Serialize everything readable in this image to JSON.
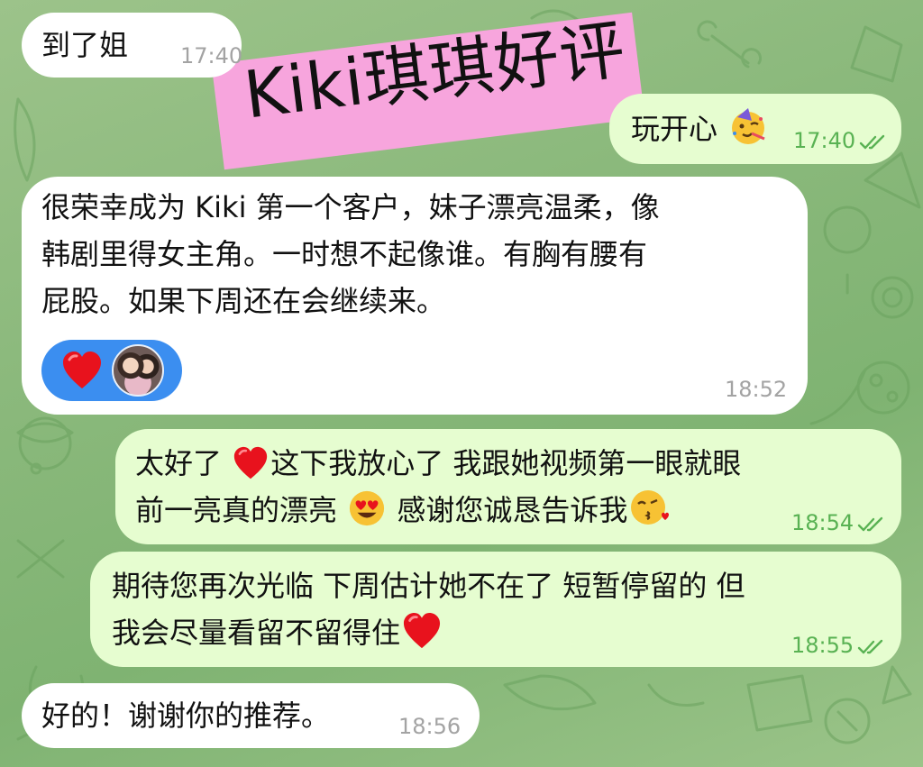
{
  "overlay": {
    "sticker_text": "Kiki琪琪好评"
  },
  "messages": [
    {
      "id": "m1",
      "direction": "incoming",
      "text": "到了姐",
      "time": "17:40"
    },
    {
      "id": "m2",
      "direction": "outgoing",
      "text": "玩开心",
      "emoji": "partying-face-emoji",
      "time": "17:40",
      "status": "read"
    },
    {
      "id": "m3",
      "direction": "incoming",
      "lines": [
        "很荣幸成为 Kiki 第一个客户，妹子漂亮温柔，像",
        "韩剧里得女主角。一时想不起像谁。有胸有腰有",
        "屁股。如果下周还在会继续来。"
      ],
      "reaction": {
        "emoji": "red-heart-emoji",
        "avatar": "reactor-avatar"
      },
      "time": "18:52"
    },
    {
      "id": "m4",
      "direction": "outgoing",
      "line1_a": "太好了 ",
      "line1_b": "这下我放心了 我跟她视频第一眼就眼",
      "line2_a": "前一亮真的漂亮 ",
      "line2_b": " 感谢您诚恳告诉我",
      "emojis": [
        "red-heart-emoji",
        "heart-eyes-emoji",
        "face-blowing-kiss-emoji"
      ],
      "time": "18:54",
      "status": "read"
    },
    {
      "id": "m5",
      "direction": "outgoing",
      "line1": "期待您再次光临 下周估计她不在了 短暂停留的 但",
      "line2": "我会尽量看留不留得住",
      "emoji": "red-heart-emoji",
      "time": "18:55",
      "status": "read"
    },
    {
      "id": "m6",
      "direction": "incoming",
      "text": "好的！谢谢你的推荐。",
      "time": "18:56"
    }
  ],
  "colors": {
    "incoming_bubble": "#ffffff",
    "outgoing_bubble": "#e6fdd0",
    "outgoing_time": "#59b253",
    "incoming_time": "#a3a3a3",
    "sticker": "#f7a5dd",
    "reaction_pill": "#3b8ef0"
  }
}
